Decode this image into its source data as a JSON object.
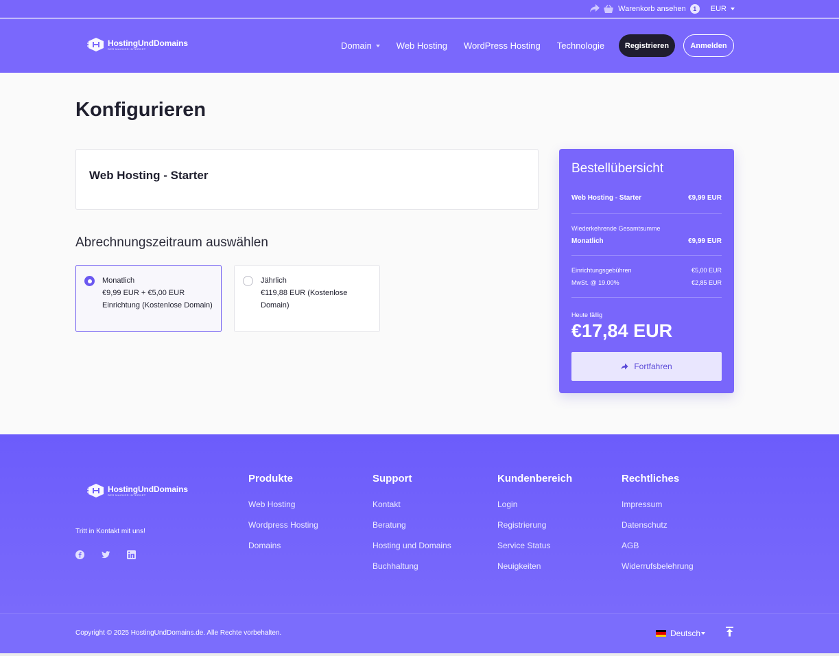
{
  "topbar": {
    "cart_label": "Warenkorb ansehen",
    "cart_count": "1",
    "currency": "EUR"
  },
  "brand": {
    "name": "HostingUndDomains",
    "tagline": "DER MACHER INTERNET"
  },
  "nav": {
    "items": [
      {
        "label": "Domain"
      },
      {
        "label": "Web Hosting"
      },
      {
        "label": "WordPress Hosting"
      },
      {
        "label": "Technologie"
      }
    ],
    "register_label": "Registrieren",
    "login_label": "Anmelden"
  },
  "main": {
    "title": "Konfigurieren",
    "product_name": "Web Hosting - Starter",
    "cycle_title": "Abrechnungszeitraum auswählen",
    "cycles": [
      {
        "label": "Monatlich",
        "price": "€9,99 EUR + €5,00 EUR Einrichtung (Kostenlose Domain)",
        "selected": true
      },
      {
        "label": "Jährlich",
        "price": "€119,88 EUR (Kostenlose Domain)",
        "selected": false
      }
    ]
  },
  "summary": {
    "title": "Bestellübersicht",
    "product_name": "Web Hosting - Starter",
    "product_price": "€9,99 EUR",
    "recurring_label": "Wiederkehrende Gesamtsumme",
    "recurring_cycle": "Monatlich",
    "recurring_price": "€9,99 EUR",
    "setup_label": "Einrichtungsgebühren",
    "setup_price": "€5,00 EUR",
    "tax_label": "MwSt. @ 19.00%",
    "tax_price": "€2,85 EUR",
    "due_label": "Heute fällig",
    "due_amount": "€17,84 EUR",
    "continue_label": "Fortfahren"
  },
  "footer": {
    "contact_text": "Tritt in Kontakt mit uns!",
    "columns": [
      {
        "heading": "Produkte",
        "links": [
          "Web Hosting",
          "Wordpress Hosting",
          "Domains"
        ]
      },
      {
        "heading": "Support",
        "links": [
          "Kontakt",
          "Beratung",
          "Hosting und Domains",
          "Buchhaltung"
        ]
      },
      {
        "heading": "Kundenbereich",
        "links": [
          "Login",
          "Registrierung",
          "Service Status",
          "Neuigkeiten"
        ]
      },
      {
        "heading": "Rechtliches",
        "links": [
          "Impressum",
          "Datenschutz",
          "AGB",
          "Widerrufsbelehrung"
        ]
      }
    ],
    "copyright": "Copyright © 2025 HostingUndDomains.de. Alle Rechte vorbehalten.",
    "language": "Deutsch"
  },
  "colors": {
    "brand": "#7966fb",
    "dark_button": "#1f1d2f",
    "selected_border": "#6b58f0"
  },
  "icons": {
    "share": "share-arrow-icon",
    "cart": "basket-icon",
    "continue": "arrow-right-icon",
    "social": [
      "facebook-icon",
      "twitter-icon",
      "linkedin-icon"
    ],
    "back_to_top": "arrow-up-icon"
  }
}
